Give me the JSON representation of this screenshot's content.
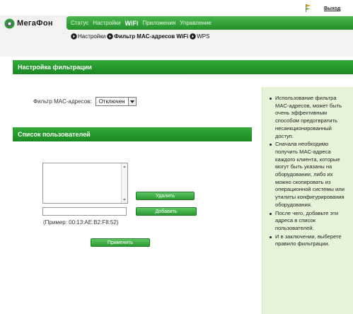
{
  "top": {
    "logout": "Выход",
    "flag_icon": "flag-icon"
  },
  "header": {
    "logo_text": "МегаФон",
    "logo_icon": "megafon-logo-icon",
    "menu": [
      {
        "label": "Статус",
        "active": false
      },
      {
        "label": "Настройки",
        "active": false
      },
      {
        "label": "WiFi",
        "active": true
      },
      {
        "label": "Приложения",
        "active": false
      },
      {
        "label": "Управление",
        "active": false
      }
    ],
    "subnav": [
      {
        "label": "Настройки",
        "active": false
      },
      {
        "label": "Фильтр MAC-адресов WiFi",
        "active": true
      },
      {
        "label": "WPS",
        "active": false
      }
    ]
  },
  "filter_section": {
    "title": "Настройка фильтрации",
    "label": "Фильтр MAC-адресов:",
    "selected_value": "Отключен"
  },
  "users_section": {
    "title": "Список пользователей",
    "mac_input_value": "",
    "example": "(Пример: 00:13:AE:B2:F8:52)",
    "delete_label": "Удалить",
    "add_label": "Добавить",
    "apply_label": "Применить"
  },
  "help": [
    "Использование фильтра MAC-адресов, может быть очень эффективным способом предотвратить несанкционированный доступ.",
    "Сначала необходимо получить MAC-адреса каждого клиента, которые могут быть указаны на оборудовании, либо их можно скопировать из операционной системы или утилиты конфигурирования оборудования.",
    "После чего, добавьте эти адреса в список пользователей.",
    "И в заключении, выберете правило фильтрации."
  ],
  "colors": {
    "accent_green": "#2a9a31",
    "help_background": "#e7f3d9"
  }
}
